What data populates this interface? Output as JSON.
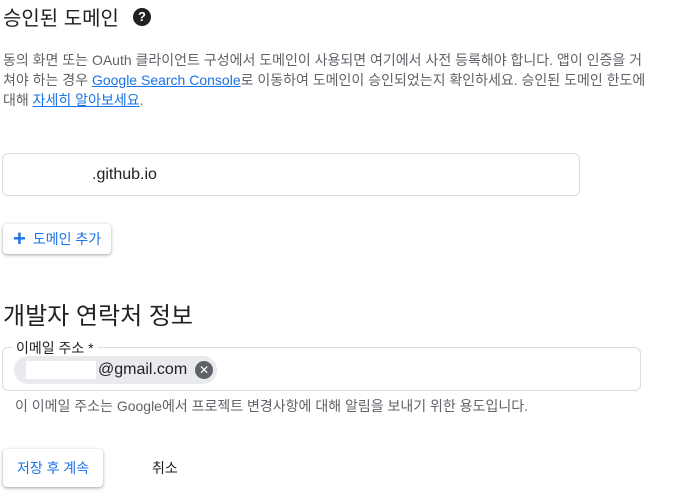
{
  "authorized_domains": {
    "title": "승인된 도메인",
    "help_icon": "question-circle-icon",
    "description_part1": "동의 화면 또는 OAuth 클라이언트 구성에서 도메인이 사용되면 여기에서 사전 등록해야 합니다. 앱이 인증을 거쳐야 하는 경우 ",
    "search_console_link": "Google Search Console",
    "description_part2": "로 이동하여 도메인이 승인되었는지 확인하세요. 승인된 도메인 한도에 대해 ",
    "learn_more_link": "자세히 알아보세요",
    "description_part3": ".",
    "domain_value_suffix": ".github.io",
    "add_domain_label": "도메인 추가"
  },
  "developer_contact": {
    "title": "개발자 연락처 정보",
    "email_label": "이메일 주소 *",
    "email_chip_suffix": "@gmail.com",
    "hint": "이 이메일 주소는 Google에서 프로젝트 변경사항에 대해 알림을 보내기 위한 용도입니다."
  },
  "actions": {
    "save_label": "저장 후 계속",
    "cancel_label": "취소"
  },
  "colors": {
    "link": "#1a73e8",
    "text": "#202124",
    "secondary_text": "#5f6368",
    "border": "#dadce0"
  }
}
